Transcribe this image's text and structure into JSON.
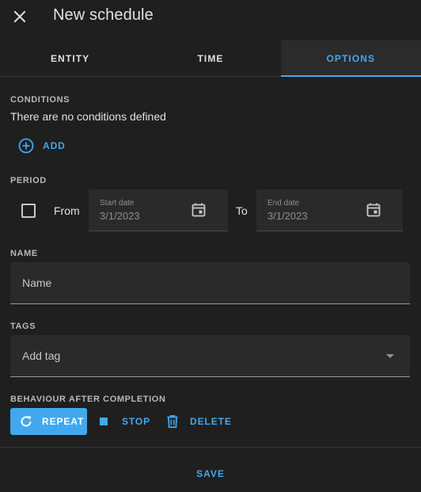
{
  "header": {
    "title": "New schedule"
  },
  "tabs": [
    {
      "label": "ENTITY"
    },
    {
      "label": "TIME"
    },
    {
      "label": "OPTIONS"
    }
  ],
  "active_tab": "OPTIONS",
  "conditions": {
    "label": "CONDITIONS",
    "empty_text": "There are no conditions defined",
    "add_label": "ADD"
  },
  "period": {
    "label": "PERIOD",
    "enabled": false,
    "from_label": "From",
    "to_label": "To",
    "start_date": {
      "label": "Start date",
      "value": "3/1/2023"
    },
    "end_date": {
      "label": "End date",
      "value": "3/1/2023"
    }
  },
  "name": {
    "label": "NAME",
    "placeholder": "Name",
    "value": ""
  },
  "tags": {
    "label": "TAGS",
    "placeholder": "Add tag"
  },
  "behaviour": {
    "label": "BEHAVIOUR AFTER COMPLETION",
    "selected": "REPEAT",
    "options": [
      {
        "label": "REPEAT"
      },
      {
        "label": "STOP"
      },
      {
        "label": "DELETE"
      }
    ]
  },
  "footer": {
    "save_label": "SAVE"
  },
  "colors": {
    "accent": "#41a8f0",
    "background": "#1f1f1f",
    "field": "#2a2a2a"
  }
}
